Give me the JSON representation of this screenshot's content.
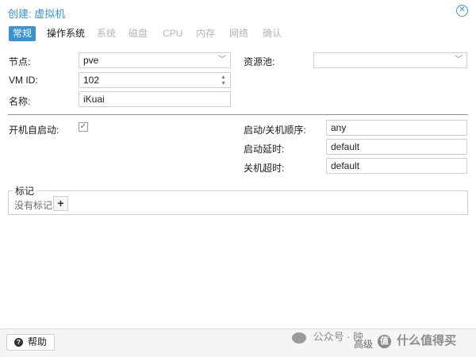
{
  "dialog": {
    "title": "创建: 虚拟机"
  },
  "tabs": [
    {
      "label": "常规",
      "state": "active"
    },
    {
      "label": "操作系统",
      "state": "normal"
    },
    {
      "label": "系统",
      "state": "disabled"
    },
    {
      "label": "磁盘",
      "state": "disabled"
    },
    {
      "label": "CPU",
      "state": "disabled"
    },
    {
      "label": "内存",
      "state": "disabled"
    },
    {
      "label": "网络",
      "state": "disabled"
    },
    {
      "label": "确认",
      "state": "disabled"
    }
  ],
  "form": {
    "node_label": "节点:",
    "node_value": "pve",
    "vmid_label": "VM ID:",
    "vmid_value": "102",
    "name_label": "名称:",
    "name_value": "iKuai",
    "pool_label": "资源池:",
    "pool_value": "",
    "onboot_label": "开机自启动:",
    "onboot_checked": true,
    "order_label": "启动/关机顺序:",
    "order_value": "any",
    "startup_delay_label": "启动延时:",
    "startup_delay_value": "default",
    "shutdown_timeout_label": "关机超时:",
    "shutdown_timeout_value": "default"
  },
  "tags": {
    "legend": "标记",
    "empty_text": "没有标记"
  },
  "footer": {
    "help_label": "帮助",
    "advanced_label": "高级"
  },
  "watermark": {
    "left_text": "公众号 · 映",
    "right_text": "什么值得买",
    "badge": "值"
  },
  "colors": {
    "accent": "#3892d4",
    "disabled_text": "#b5b5b5",
    "border": "#cfcfcf"
  },
  "icons": {
    "close": "close-icon",
    "dropdown": "chevron-down-icon",
    "spinner": "spinner-icon",
    "checkbox": "check-icon",
    "add": "plus-icon",
    "help": "question-icon"
  }
}
